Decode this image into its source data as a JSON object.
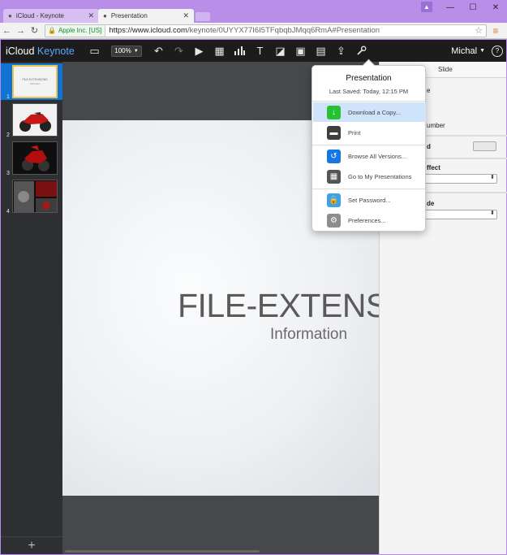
{
  "browser": {
    "tabs": [
      {
        "title": "iCloud - Keynote",
        "active": false
      },
      {
        "title": "Presentation",
        "active": true
      }
    ],
    "ev_org": "Apple Inc. [US]",
    "url_host": "https://www.icloud.com",
    "url_path": "/keynote/0UYYX77I6I5TFqbqbJMqq6RmA#Presentation"
  },
  "app": {
    "brand_icloud": "iCloud",
    "brand_keynote": "Keynote",
    "zoom": "100%",
    "user": "Michal",
    "help": "?"
  },
  "slides": [
    {
      "num": "1",
      "title": "FILE-EXTENSIONS",
      "subtitle": "Information"
    },
    {
      "num": "2"
    },
    {
      "num": "3"
    },
    {
      "num": "4"
    }
  ],
  "slide": {
    "title": "FILE-EXTENSIO",
    "subtitle": "Information"
  },
  "inspector": {
    "tab_slide": "Slide",
    "frag_e": "e",
    "frag_number": "umber",
    "frag_d": "d",
    "frag_effect": "ffect",
    "frag_de": "de"
  },
  "popover": {
    "title": "Presentation",
    "last_saved": "Last Saved: Today, 12:15 PM",
    "items": [
      {
        "label": "Download a Copy...",
        "color": "#27c233"
      },
      {
        "label": "Print",
        "color": "#3f3f3f"
      },
      {
        "label": "Browse All Versions...",
        "color": "#1577e3"
      },
      {
        "label": "Go to My Presentations",
        "color": "#555555"
      },
      {
        "label": "Set Password...",
        "color": "#3ea1e8"
      },
      {
        "label": "Preferences...",
        "color": "#8d8d8d"
      }
    ]
  },
  "colors": {
    "titlebar": "#b98ee9",
    "toolbar": "#1c1c1c",
    "selection": "#0f74d3",
    "keynote_blue": "#5aa9ff"
  }
}
